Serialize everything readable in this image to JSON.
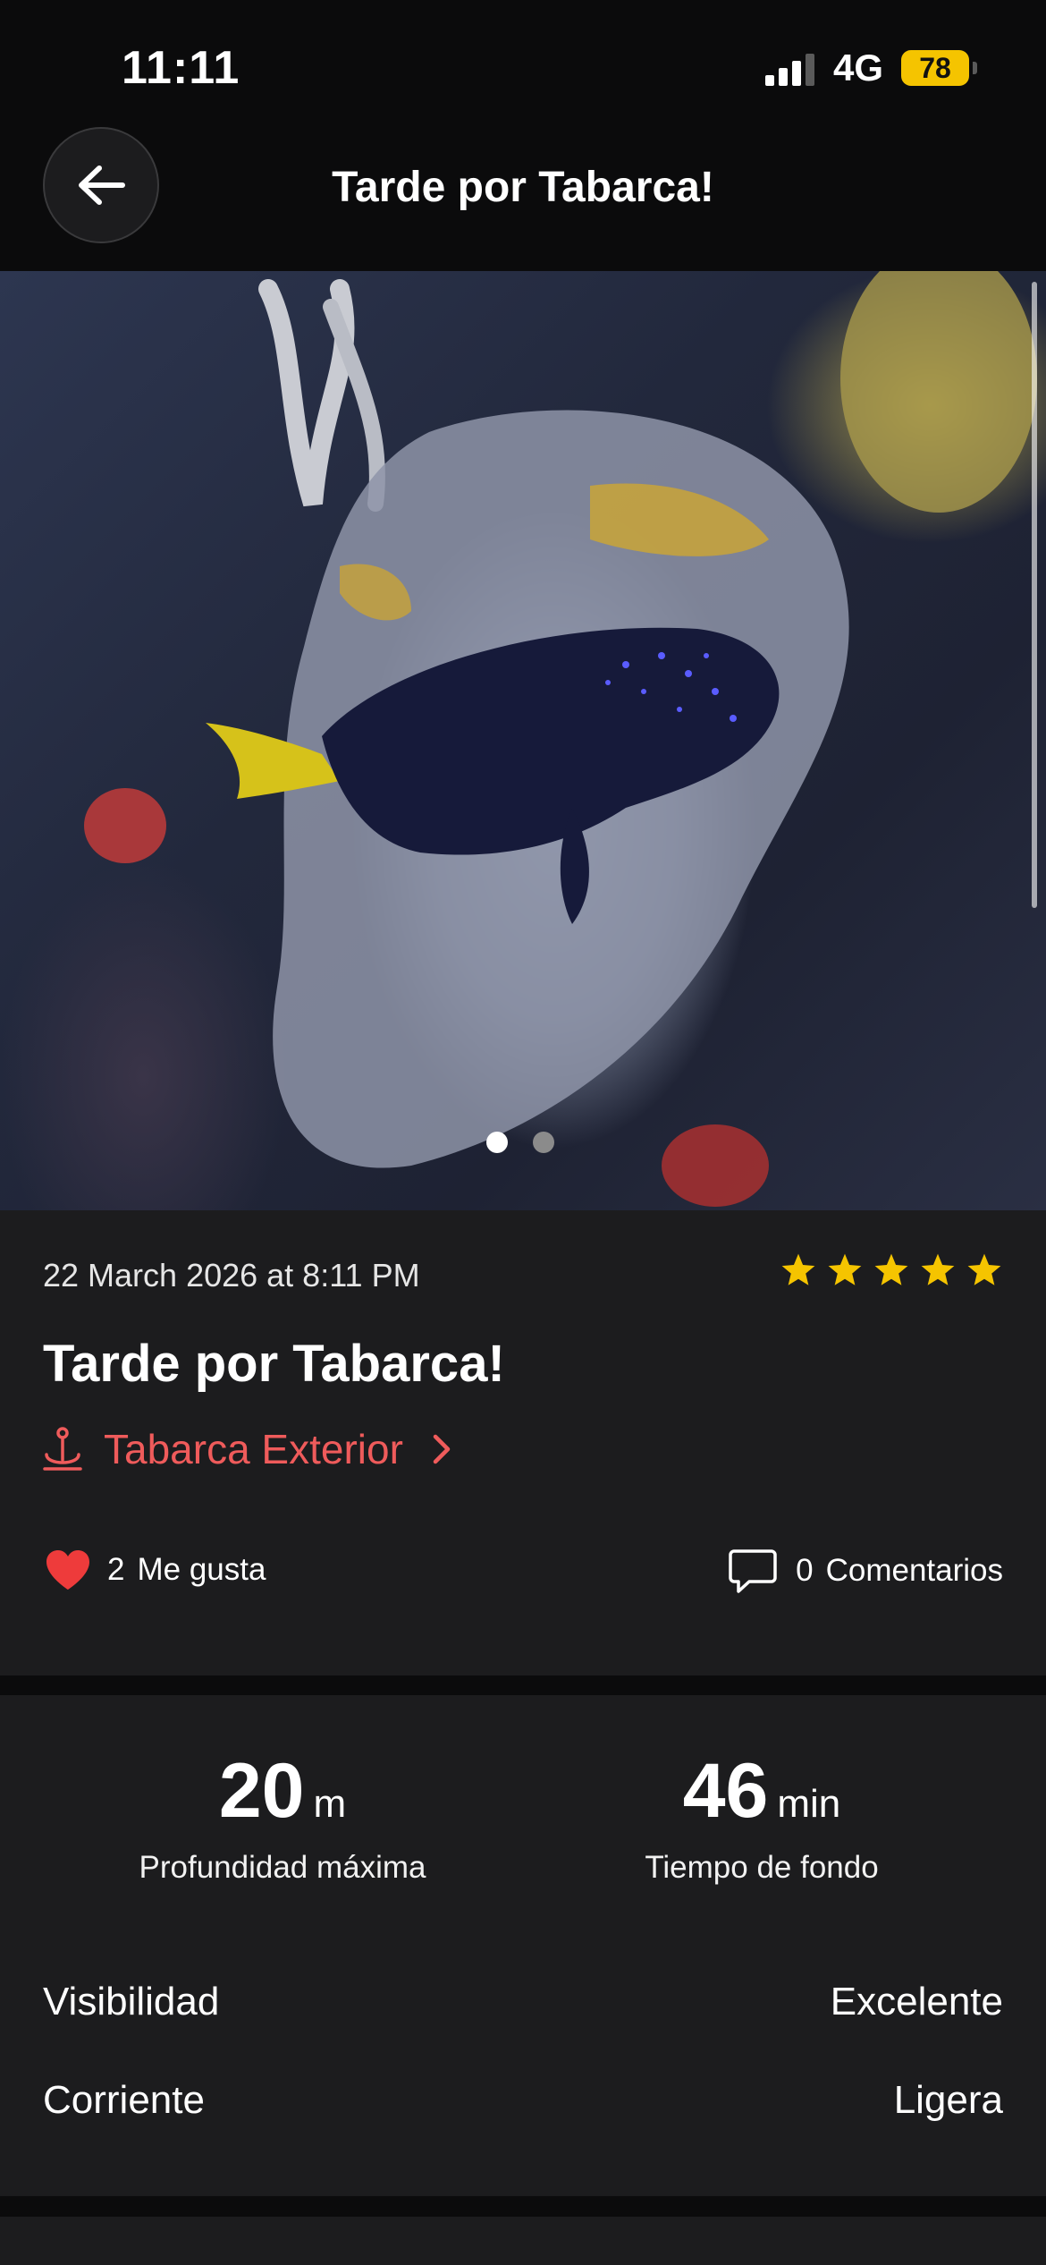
{
  "status_bar": {
    "time": "11:11",
    "network": "4G",
    "battery": "78"
  },
  "header": {
    "title": "Tarde por Tabarca!",
    "back_icon": "arrow-left-icon"
  },
  "carousel": {
    "total": 2,
    "active_index": 0
  },
  "post": {
    "date": "22 March 2026 at 8:11 PM",
    "rating": 5,
    "rating_max": 5,
    "title": "Tarde por Tabarca!",
    "location": "Tabarca Exterior",
    "likes_count": "2",
    "likes_label": "Me gusta",
    "comments_count": "0",
    "comments_label": "Comentarios"
  },
  "stats": {
    "max_depth": {
      "value": "20",
      "unit": "m",
      "label": "Profundidad máxima"
    },
    "bottom_time": {
      "value": "46",
      "unit": "min",
      "label": "Tiempo de fondo"
    },
    "conditions": [
      {
        "label": "Visibilidad",
        "value": "Excelente"
      },
      {
        "label": "Corriente",
        "value": "Ligera"
      }
    ]
  },
  "colors": {
    "accent": "#ef5b5b",
    "star": "#f5c400",
    "heart": "#ee3b3b",
    "card": "#1c1c1e"
  }
}
